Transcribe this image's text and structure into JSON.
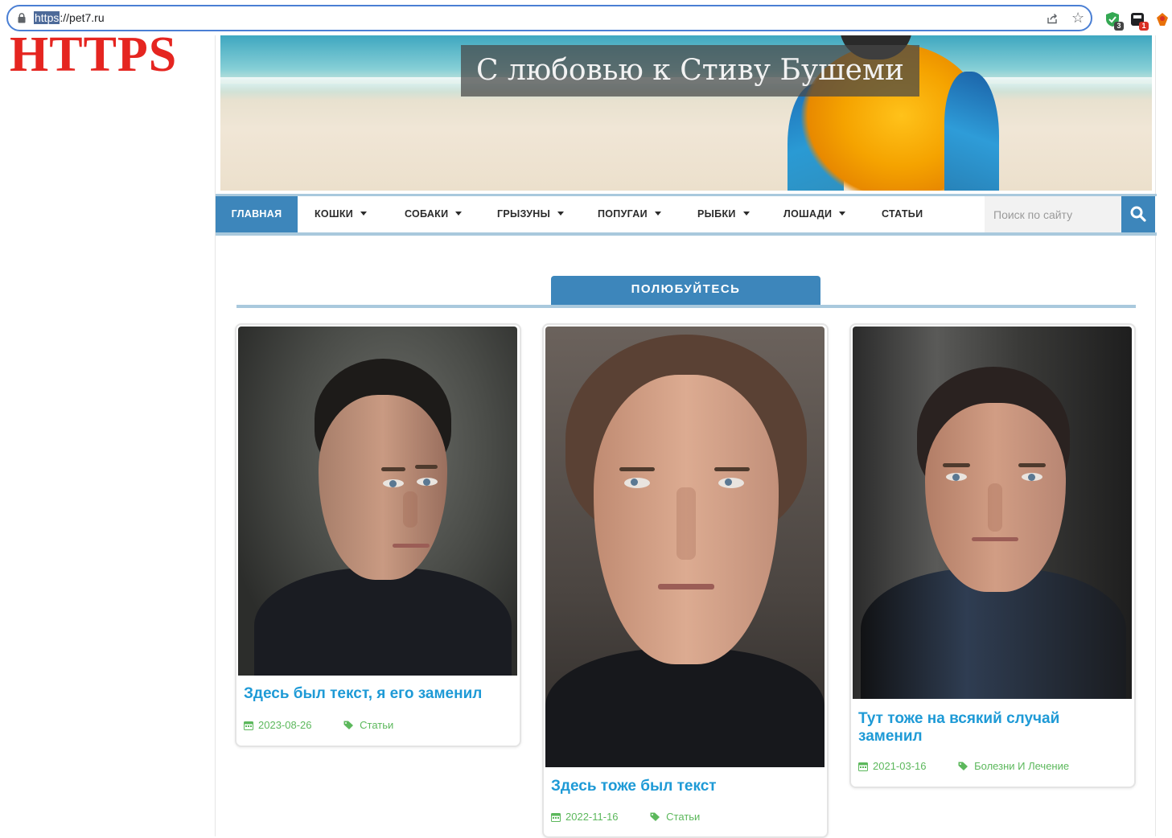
{
  "browser": {
    "url_scheme": "https",
    "url_rest": "://pet7.ru",
    "extensions": [
      {
        "name": "shield-check-extension",
        "color": "#34a853",
        "badge": "3",
        "badge_color": "#444444"
      },
      {
        "name": "dark-extension",
        "color": "#202124",
        "badge": "1",
        "badge_color": "#d93025"
      },
      {
        "name": "red-extension",
        "color": "#e8710a",
        "badge": "",
        "badge_color": "#d93025"
      }
    ]
  },
  "overlay_label": "HTTPS",
  "site": {
    "banner_title": "С любовью к Стиву Бушеми",
    "nav": {
      "items": [
        {
          "label": "ГЛАВНАЯ",
          "active": true,
          "dropdown": false
        },
        {
          "label": "КОШКИ",
          "active": false,
          "dropdown": true
        },
        {
          "label": "СОБАКИ",
          "active": false,
          "dropdown": true
        },
        {
          "label": "ГРЫЗУНЫ",
          "active": false,
          "dropdown": true
        },
        {
          "label": "ПОПУГАИ",
          "active": false,
          "dropdown": true
        },
        {
          "label": "РЫБКИ",
          "active": false,
          "dropdown": true
        },
        {
          "label": "ЛОШАДИ",
          "active": false,
          "dropdown": true
        },
        {
          "label": "СТАТЬИ",
          "active": false,
          "dropdown": false
        }
      ],
      "search_placeholder": "Поиск по сайту"
    },
    "section_title": "ПОЛЮБУЙТЕСЬ",
    "cards": [
      {
        "title": "Здесь был текст, я его заменил",
        "date": "2023-08-26",
        "category": "Статьи"
      },
      {
        "title": "Здесь тоже был текст",
        "date": "2022-11-16",
        "category": "Статьи"
      },
      {
        "title": "Тут тоже на всякий случай заменил",
        "date": "2021-03-16",
        "category": "Болезни И Лечение"
      }
    ],
    "colors": {
      "accent": "#3d86bb",
      "link": "#1e9ad6",
      "meta": "#5cb85c",
      "overlay": "#e52520"
    }
  }
}
